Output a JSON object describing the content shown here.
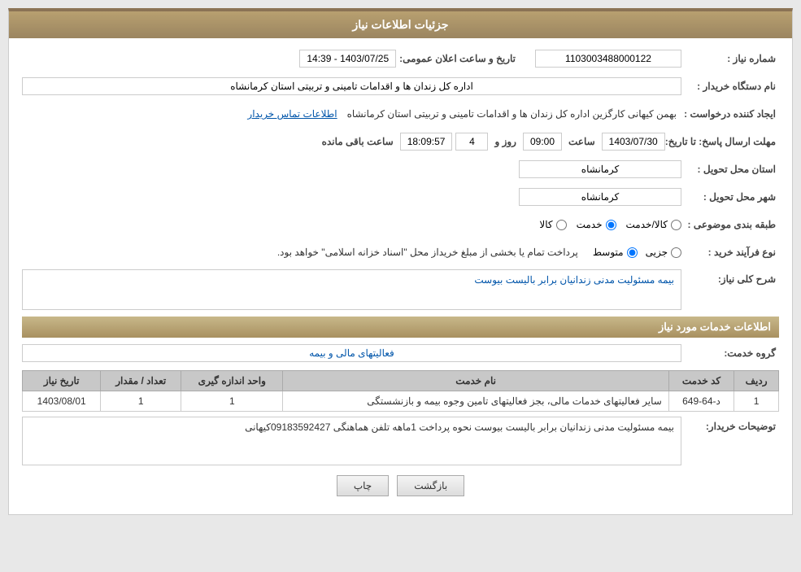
{
  "header": {
    "title": "جزئیات اطلاعات نیاز"
  },
  "fields": {
    "need_number_label": "شماره نیاز :",
    "need_number_value": "1103003488000122",
    "announce_datetime_label": "تاریخ و ساعت اعلان عمومی:",
    "announce_datetime_value": "1403/07/25 - 14:39",
    "buyer_org_label": "نام دستگاه خریدار :",
    "buyer_org_value": "اداره کل زندان ها و اقدامات تامینی و تربیتی استان کرمانشاه",
    "creator_label": "ایجاد کننده درخواست :",
    "creator_value": "بهمن کیهانی کارگزین اداره کل زندان ها و اقدامات تامینی و تربیتی استان کرمانشاه",
    "creator_link": "اطلاعات تماس خریدار",
    "deadline_label": "مهلت ارسال پاسخ: تا تاریخ:",
    "deadline_date": "1403/07/30",
    "deadline_time_label": "ساعت",
    "deadline_time": "09:00",
    "deadline_day_label": "روز و",
    "deadline_days": "4",
    "deadline_remaining_label": "ساعت باقی مانده",
    "deadline_remaining": "18:09:57",
    "province_label": "استان محل تحویل :",
    "province_value": "کرمانشاه",
    "city_label": "شهر محل تحویل :",
    "city_value": "کرمانشاه",
    "category_label": "طبقه بندی موضوعی :",
    "category_options": [
      "کالا",
      "خدمت",
      "کالا/خدمت"
    ],
    "category_selected": "خدمت",
    "purchase_type_label": "نوع فرآیند خرید :",
    "purchase_options": [
      "جزیی",
      "متوسط"
    ],
    "purchase_selected": "متوسط",
    "purchase_description": "پرداخت تمام یا بخشی از مبلغ خریداز محل \"اسناد خزانه اسلامی\" خواهد بود.",
    "need_desc_label": "شرح کلی نیاز:",
    "need_desc_value": "بیمه مسئولیت مدنی زندانیان برابر بالیست بیوست",
    "services_header": "اطلاعات خدمات مورد نیاز",
    "service_group_label": "گروه خدمت:",
    "service_group_value": "فعالیتهای مالی و بیمه",
    "table": {
      "headers": [
        "ردیف",
        "کد خدمت",
        "نام خدمت",
        "واحد اندازه گیری",
        "تعداد / مقدار",
        "تاریخ نیاز"
      ],
      "rows": [
        {
          "row_num": "1",
          "service_code": "د-64-649",
          "service_name": "سایر فعالیتهای خدمات مالی، بجز فعالیتهای تامین وجوه بیمه و بازنشستگی",
          "unit": "1",
          "quantity": "1",
          "need_date": "1403/08/01"
        }
      ]
    },
    "buyer_desc_label": "توضیحات خریدار:",
    "buyer_desc_value": "بیمه مسئولیت مدنی زندانیان  برابر بالیست بیوست نحوه پرداخت 1ماهه تلفن هماهنگی 09183592427کیهانی"
  },
  "buttons": {
    "print_label": "چاپ",
    "back_label": "بازگشت"
  }
}
